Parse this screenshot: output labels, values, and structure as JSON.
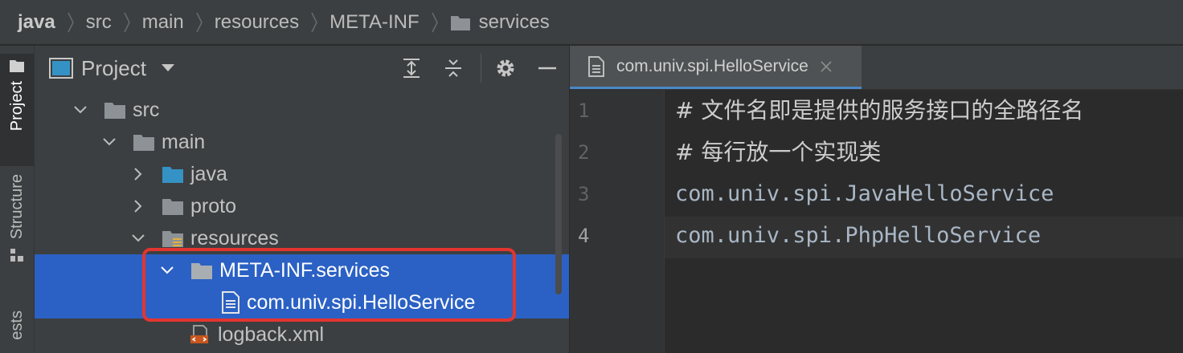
{
  "breadcrumb": [
    "java",
    "src",
    "main",
    "resources",
    "META-INF",
    "services"
  ],
  "toolstrip": {
    "project_label": "Project",
    "structure_label": "Structure",
    "tests_label": "ests"
  },
  "project_panel": {
    "title": "Project",
    "tree": [
      {
        "label": "src",
        "icon": "folder-icon",
        "expanded": true
      },
      {
        "label": "main",
        "icon": "folder-icon",
        "expanded": true
      },
      {
        "label": "java",
        "icon": "source-folder-icon",
        "expanded": false
      },
      {
        "label": "proto",
        "icon": "folder-icon",
        "expanded": false
      },
      {
        "label": "resources",
        "icon": "resources-folder-icon",
        "expanded": true
      },
      {
        "label": "META-INF.services",
        "icon": "folder-icon",
        "expanded": true,
        "selected": true
      },
      {
        "label": "com.univ.spi.HelloService",
        "icon": "text-file-icon",
        "selected": true
      },
      {
        "label": "logback.xml",
        "icon": "xml-file-icon"
      }
    ]
  },
  "editor": {
    "tab_label": "com.univ.spi.HelloService",
    "lines": [
      {
        "number": "1",
        "text": "# 文件名即是提供的服务接口的全路径名"
      },
      {
        "number": "2",
        "text": "# 每行放一个实现类"
      },
      {
        "number": "3",
        "text": "com.univ.spi.JavaHelloService"
      },
      {
        "number": "4",
        "text": "com.univ.spi.PhpHelloService"
      }
    ]
  },
  "colors": {
    "selection": "#2b61c4",
    "highlight_border": "#e3352f",
    "tab_underline": "#4a88c7"
  }
}
